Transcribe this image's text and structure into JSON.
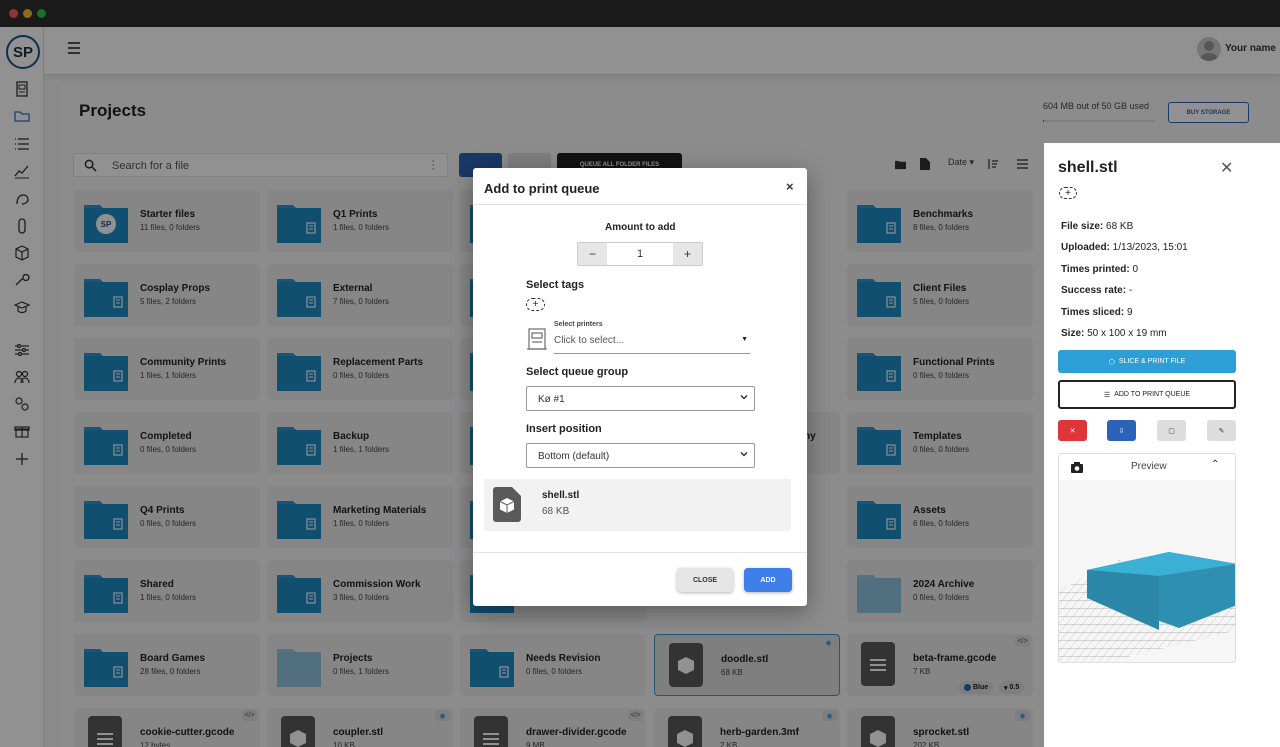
{
  "window": {
    "dots": [
      "#ff5f57",
      "#febc2e",
      "#28c840"
    ]
  },
  "app": {
    "logo": "SP",
    "user_name": "Your name"
  },
  "sidebar": {
    "items": [
      "print-queue",
      "folder",
      "list",
      "chart",
      "filament",
      "clip",
      "box",
      "wrench",
      "school",
      "sliders",
      "users",
      "gears",
      "gift",
      "plus"
    ]
  },
  "page": {
    "title": "Projects",
    "storage_text": "604 MB out of 50 GB used",
    "storage_used_fraction": 0.012,
    "buy_storage_label": "BUY STORAGE",
    "search_placeholder": "Search for a file",
    "queue_all_label": "QUEUE ALL FOLDER FILES",
    "sort_label": "Date"
  },
  "grid": {
    "rows": [
      [
        {
          "name": "Starter files",
          "meta": "11 files, 0 folders",
          "kind": "folder-logo"
        },
        {
          "name": "Q1 Prints",
          "meta": "1 files, 0 folders",
          "kind": "folder"
        },
        {
          "name": "",
          "meta": "",
          "kind": "folder"
        },
        {
          "name": "",
          "meta": "",
          "kind": "hidden"
        },
        {
          "name": "Benchmarks",
          "meta": "8 files, 0 folders",
          "kind": "folder"
        }
      ],
      [
        {
          "name": "Cosplay Props",
          "meta": "5 files, 2 folders",
          "kind": "folder"
        },
        {
          "name": "External",
          "meta": "7 files, 0 folders",
          "kind": "folder"
        },
        {
          "name": "",
          "meta": "",
          "kind": "folder"
        },
        {
          "name": "",
          "meta": "",
          "kind": "hidden"
        },
        {
          "name": "Client Files",
          "meta": "5 files, 0 folders",
          "kind": "folder"
        }
      ],
      [
        {
          "name": "Community Prints",
          "meta": "1 files, 1 folders",
          "kind": "folder"
        },
        {
          "name": "Replacement Parts",
          "meta": "0 files, 0 folders",
          "kind": "folder"
        },
        {
          "name": "",
          "meta": "",
          "kind": "folder"
        },
        {
          "name": "",
          "meta": "",
          "kind": "hidden"
        },
        {
          "name": "Functional Prints",
          "meta": "0 files, 0 folders",
          "kind": "folder"
        }
      ],
      [
        {
          "name": "Completed",
          "meta": "0 files, 0 folders",
          "kind": "folder"
        },
        {
          "name": "Backup",
          "meta": "1 files, 1 folders",
          "kind": "folder"
        },
        {
          "name": "",
          "meta": "",
          "kind": "folder"
        },
        {
          "name": "ny",
          "meta": "",
          "kind": "partial"
        },
        {
          "name": "Templates",
          "meta": "0 files, 0 folders",
          "kind": "folder"
        }
      ],
      [
        {
          "name": "Q4 Prints",
          "meta": "0 files, 0 folders",
          "kind": "folder"
        },
        {
          "name": "Marketing Materials",
          "meta": "1 files, 0 folders",
          "kind": "folder"
        },
        {
          "name": "",
          "meta": "",
          "kind": "folder"
        },
        {
          "name": "",
          "meta": "",
          "kind": "hidden"
        },
        {
          "name": "Assets",
          "meta": "6 files, 0 folders",
          "kind": "folder"
        }
      ],
      [
        {
          "name": "Shared",
          "meta": "1 files, 0 folders",
          "kind": "folder"
        },
        {
          "name": "Commission Work",
          "meta": "3 files, 0 folders",
          "kind": "folder"
        },
        {
          "name": "",
          "meta": "",
          "kind": "folder"
        },
        {
          "name": "",
          "meta": "",
          "kind": "hidden"
        },
        {
          "name": "2024 Archive",
          "meta": "0 files, 0 folders",
          "kind": "folder-light"
        }
      ],
      [
        {
          "name": "Board Games",
          "meta": "28 files, 0 folders",
          "kind": "folder"
        },
        {
          "name": "Projects",
          "meta": "0 files, 1 folders",
          "kind": "folder-light"
        },
        {
          "name": "Needs Revision",
          "meta": "0 files, 0 folders",
          "kind": "folder"
        },
        {
          "name": "doodle.stl",
          "meta": "68 KB",
          "kind": "stl",
          "selected": true
        },
        {
          "name": "beta-frame.gcode",
          "meta": "7 KB",
          "kind": "gcode",
          "filament": "Blue",
          "nozzle": "0.5"
        }
      ],
      [
        {
          "name": "cookie-cutter.gcode",
          "meta": "12 bytes",
          "kind": "gcode"
        },
        {
          "name": "coupler.stl",
          "meta": "10 KB",
          "kind": "stl"
        },
        {
          "name": "drawer-divider.gcode",
          "meta": "9 MB",
          "kind": "gcode"
        },
        {
          "name": "herb-garden.3mf",
          "meta": "2 KB",
          "kind": "stl"
        },
        {
          "name": "sprocket.stl",
          "meta": "202 KB",
          "kind": "stl"
        }
      ]
    ]
  },
  "details": {
    "title": "shell.stl",
    "tag_add": "+",
    "rows": [
      {
        "label": "File size:",
        "value": "68 KB"
      },
      {
        "label": "Uploaded:",
        "value": "1/13/2023, 15:01"
      },
      {
        "label": "Times printed:",
        "value": "0"
      },
      {
        "label": "Success rate:",
        "value": "-"
      },
      {
        "label": "Times sliced:",
        "value": "9"
      },
      {
        "label": "Size:",
        "value": "50 x 100 x 19 mm"
      }
    ],
    "slice_print_label": "SLICE & PRINT FILE",
    "add_queue_label": "ADD TO PRINT QUEUE",
    "preview_label": "Preview",
    "accent": "#2d9fd6"
  },
  "modal": {
    "title": "Add to print queue",
    "close_icon": "×",
    "amount_label": "Amount to add",
    "minus": "−",
    "plus": "+",
    "amount_value": "1",
    "tags_label": "Select tags",
    "tag_add": "+",
    "printers_label": "Select printers",
    "printers_placeholder": "Click to select...",
    "printers_arrow": "▼",
    "queue_group_label": "Select queue group",
    "queue_group_value": "Kø #1",
    "insert_position_label": "Insert position",
    "insert_position_value": "Bottom (default)",
    "file_name": "shell.stl",
    "file_size": "68 KB",
    "close_button": "CLOSE",
    "add_button": "ADD",
    "primary": "#3f7fe9"
  }
}
